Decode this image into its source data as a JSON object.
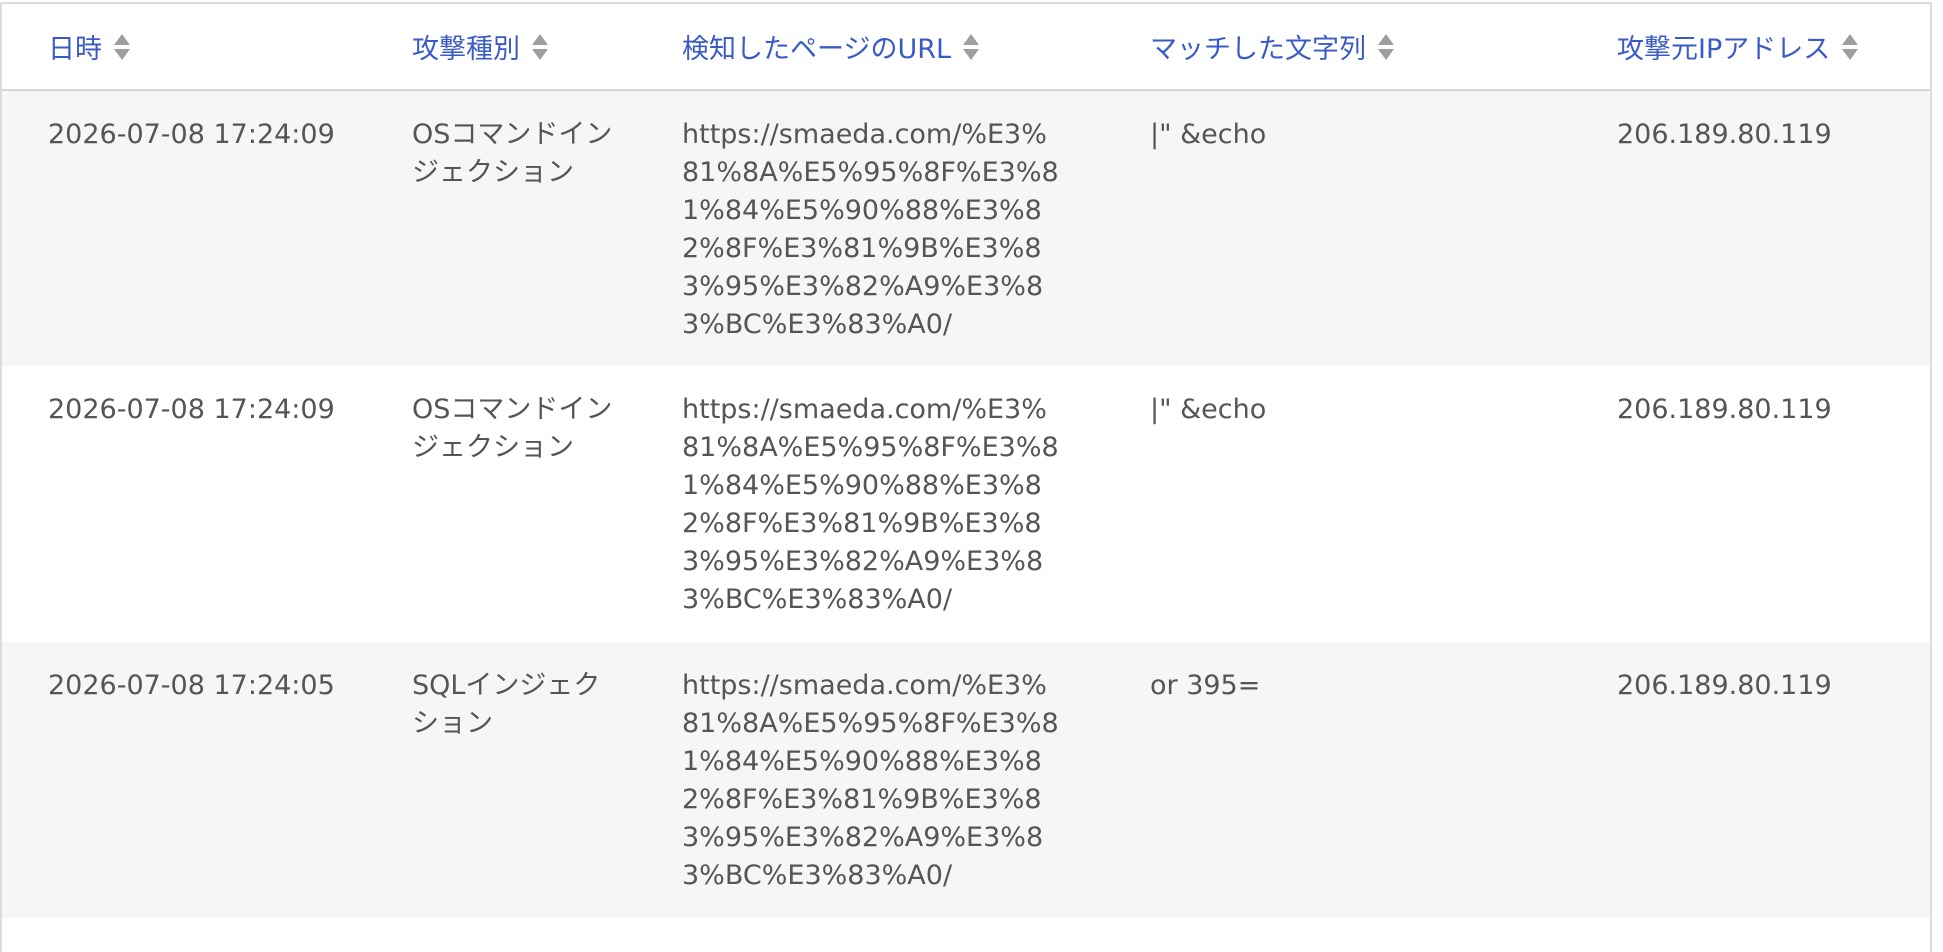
{
  "table": {
    "headers": {
      "date": "日時",
      "attack_type": "攻撃種別",
      "url": "検知したページのURL",
      "matched": "マッチした文字列",
      "source_ip": "攻撃元IPアドレス"
    },
    "rows": [
      {
        "date": "2026-07-08 17:24:09",
        "attack_type": "OSコマンドインジェクション",
        "url": "https://smaeda.com/%E3%81%8A%E5%95%8F%E3%81%84%E5%90%88%E3%82%8F%E3%81%9B%E3%83%95%E3%82%A9%E3%83%BC%E3%83%A0/",
        "matched": "|\" &echo",
        "source_ip": "206.189.80.119"
      },
      {
        "date": "2026-07-08 17:24:09",
        "attack_type": "OSコマンドインジェクション",
        "url": "https://smaeda.com/%E3%81%8A%E5%95%8F%E3%81%84%E5%90%88%E3%82%8F%E3%81%9B%E3%83%95%E3%82%A9%E3%83%BC%E3%83%A0/",
        "matched": "|\" &echo",
        "source_ip": "206.189.80.119"
      },
      {
        "date": "2026-07-08 17:24:05",
        "attack_type": "SQLインジェクション",
        "url": "https://smaeda.com/%E3%81%8A%E5%95%8F%E3%81%84%E5%90%88%E3%82%8F%E3%81%9B%E3%83%95%E3%82%A9%E3%83%BC%E3%83%A0/",
        "matched": "or 395=",
        "source_ip": "206.189.80.119"
      }
    ]
  },
  "colors": {
    "header_text": "#3a5bc7",
    "body_text": "#555555",
    "row_stripe": "#f6f6f6",
    "sort_icon": "#9e9e9e"
  },
  "icons": {
    "sort": "sort-icon"
  }
}
